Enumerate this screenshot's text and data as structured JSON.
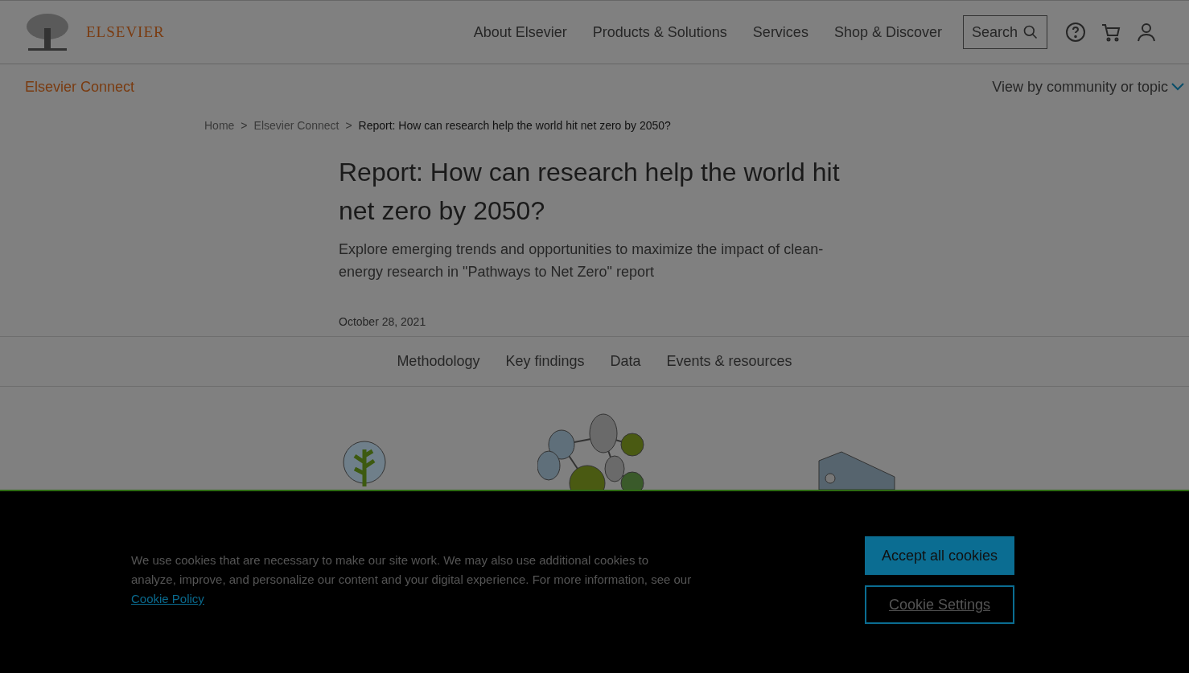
{
  "header": {
    "logo_text": "ELSEVIER",
    "nav": [
      "About Elsevier",
      "Products & Solutions",
      "Services",
      "Shop & Discover"
    ],
    "search_label": "Search"
  },
  "subheader": {
    "title": "Elsevier Connect",
    "topic_menu": "View by community or topic"
  },
  "breadcrumb": [
    {
      "label": "Home",
      "current": false
    },
    {
      "label": "Elsevier Connect",
      "current": false
    },
    {
      "label": "Report: How can research help the world hit net zero by 2050?",
      "current": true
    }
  ],
  "breadcrumb_separator": ">",
  "article": {
    "title": "Report: How can research help the world hit net zero by 2050?",
    "subtitle": "Explore emerging trends and opportunities to maximize the impact of clean-energy research in \"Pathways to Net Zero\" report",
    "date": "October 28, 2021"
  },
  "section_tabs": [
    "Methodology",
    "Key findings",
    "Data",
    "Events & resources"
  ],
  "cookie_banner": {
    "text": "We use cookies that are necessary to make our site work. We may also use additional cookies to analyze, improve, and personalize our content and your digital experience. For more information, see our",
    "link": "Cookie Policy",
    "accept_button": "Accept all cookies",
    "settings_button": "Cookie Settings"
  }
}
